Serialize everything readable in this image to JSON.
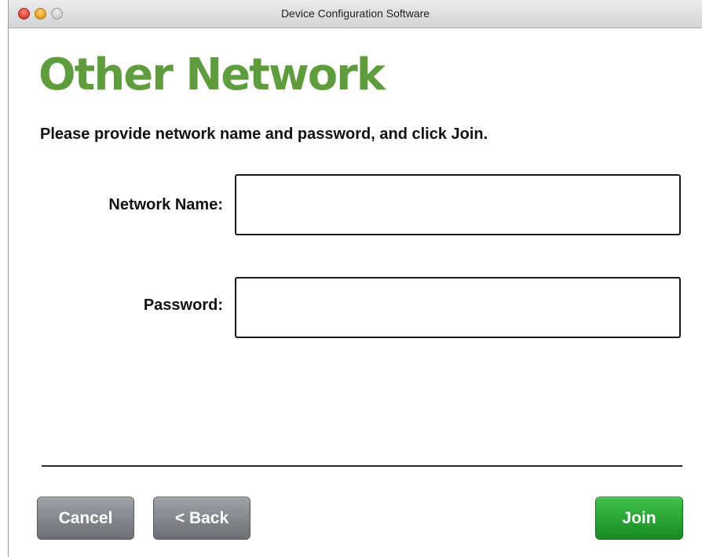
{
  "window": {
    "title": "Device Configuration Software"
  },
  "page": {
    "heading": "Other Network",
    "instruction": "Please provide network name and password, and click Join."
  },
  "form": {
    "network_name_label": "Network Name:",
    "network_name_value": "",
    "network_name_placeholder": "",
    "password_label": "Password:",
    "password_value": "",
    "password_placeholder": ""
  },
  "buttons": {
    "cancel": "Cancel",
    "back": "< Back",
    "join": "Join"
  },
  "colors": {
    "heading": "#5f9c3d",
    "join_button": "#2aa636",
    "secondary_button": "#85898e"
  },
  "icons": {
    "close": "close-icon",
    "minimize": "minimize-icon",
    "zoom": "zoom-icon"
  }
}
